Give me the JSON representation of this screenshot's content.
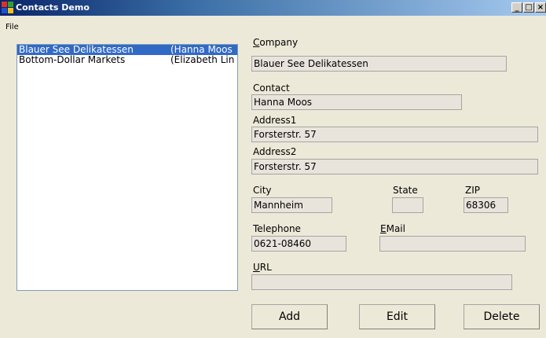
{
  "window": {
    "title": "Contacts Demo",
    "minimize": "_",
    "maximize": "□",
    "close": "×"
  },
  "menu": {
    "file": "File"
  },
  "contacts": [
    {
      "company": "Blauer See Delikatessen",
      "contact": "(Hanna Moos",
      "selected": true
    },
    {
      "company": "Bottom-Dollar Markets",
      "contact": "(Elizabeth Lin",
      "selected": false
    }
  ],
  "labels": {
    "company_key": "C",
    "company_rest": "ompany",
    "contact": "Contact",
    "address1": "Address1",
    "address2": "Address2",
    "city": "City",
    "state": "State",
    "zip": "ZIP",
    "telephone": "Telephone",
    "email_key": "E",
    "email_rest": "Mail",
    "url_key": "U",
    "url_rest": "RL"
  },
  "fields": {
    "company": "Blauer See Delikatessen",
    "contact": "Hanna Moos",
    "address1": "Forsterstr. 57",
    "address2": "Forsterstr. 57",
    "city": "Mannheim",
    "state": "",
    "zip": "68306",
    "telephone": "0621-08460",
    "email": "",
    "url": ""
  },
  "buttons": {
    "add": "Add",
    "edit": "Edit",
    "delete": "Delete"
  },
  "colors": {
    "titlebar_start": "#0a246a",
    "selection": "#316ac5",
    "background": "#ece9d8"
  }
}
